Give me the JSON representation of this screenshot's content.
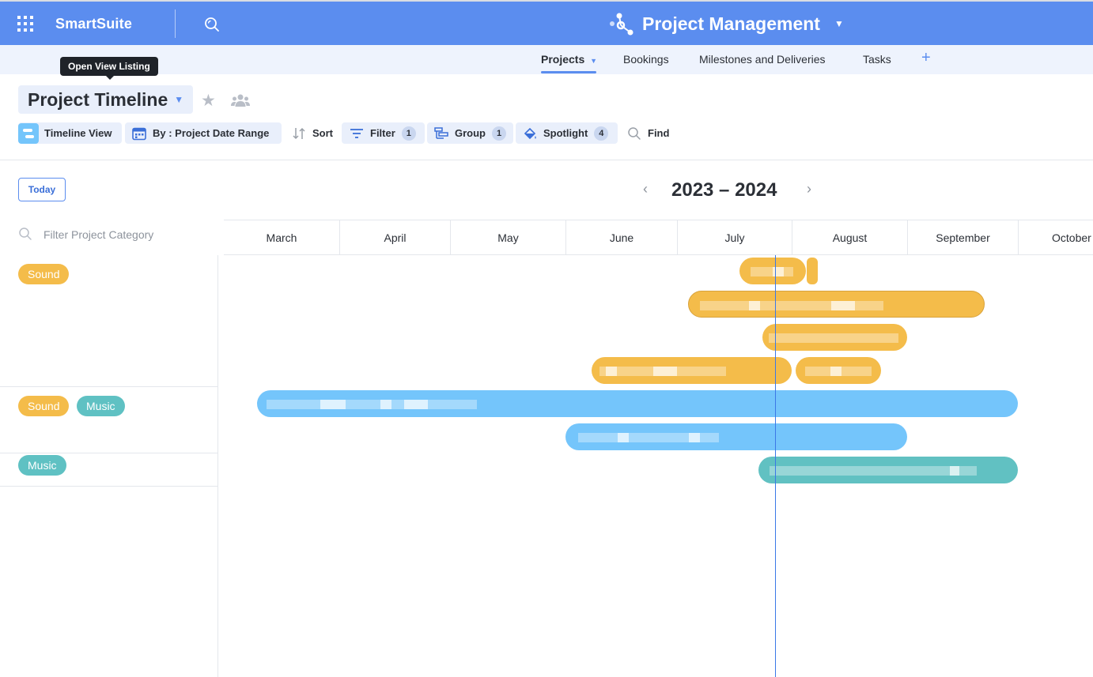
{
  "header": {
    "brand": "SmartSuite",
    "solution_title": "Project Management",
    "accent": "#5b8def"
  },
  "tabs": [
    {
      "label": "Projects",
      "active": true
    },
    {
      "label": "Bookings",
      "active": false
    },
    {
      "label": "Milestones and Deliveries",
      "active": false
    },
    {
      "label": "Tasks",
      "active": false
    }
  ],
  "tooltip": "Open View Listing",
  "view": {
    "title": "Project Timeline"
  },
  "toolbar": {
    "timeline_view": "Timeline View",
    "by_range": "By : Project Date Range",
    "sort": "Sort",
    "filter": "Filter",
    "filter_count": "1",
    "group": "Group",
    "group_count": "1",
    "spotlight": "Spotlight",
    "spotlight_count": "4",
    "find": "Find"
  },
  "timeline": {
    "today_label": "Today",
    "year_range": "2023 – 2024",
    "filter_placeholder": "Filter Project Category",
    "months": [
      "March",
      "April",
      "May",
      "June",
      "July",
      "August",
      "September",
      "October"
    ]
  },
  "groups": [
    {
      "tags": [
        "Sound"
      ]
    },
    {
      "tags": [
        "Sound",
        "Music"
      ]
    },
    {
      "tags": [
        "Music"
      ]
    }
  ],
  "colors": {
    "sound": "#f4bc4a",
    "music": "#5fc1c3",
    "blue_bar": "#74c5fb",
    "today_line": "#3b78e7"
  }
}
